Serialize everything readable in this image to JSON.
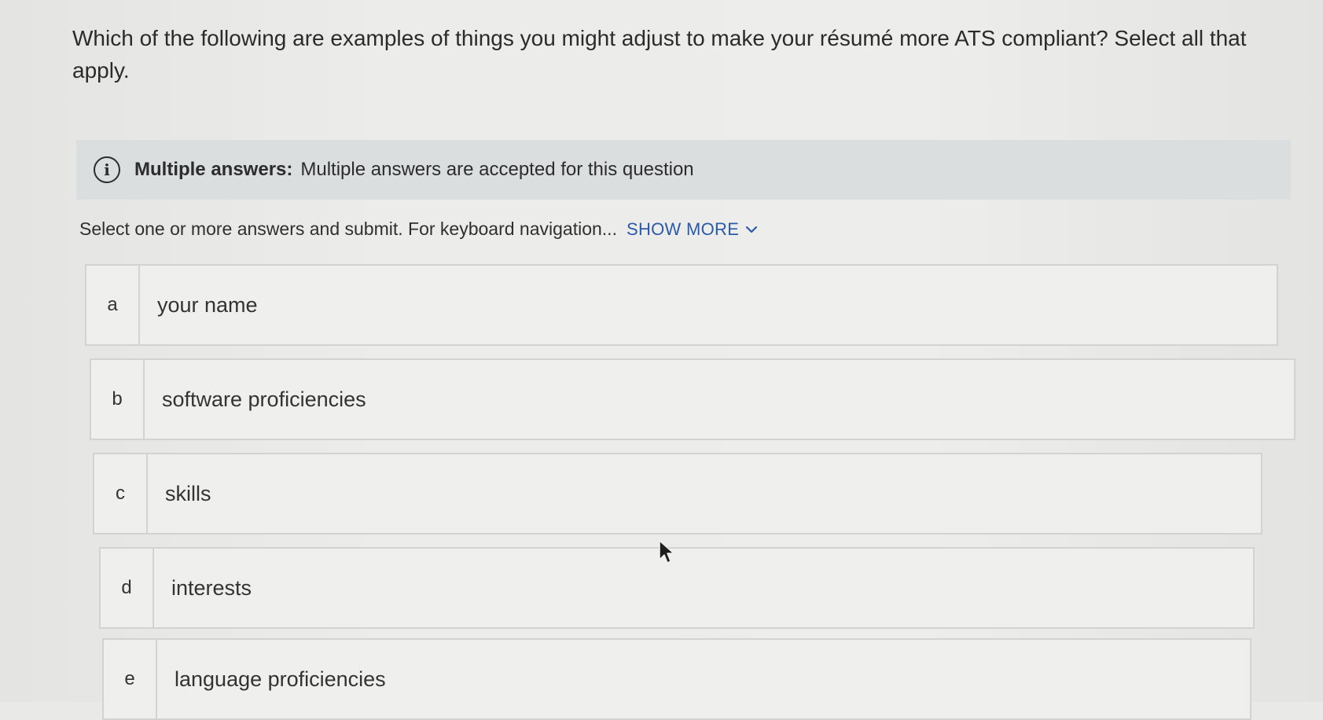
{
  "question": {
    "text": "Which of the following are examples of things you might adjust to make your résumé more ATS compliant? Select all that apply."
  },
  "banner": {
    "icon": "info-icon",
    "strong_label": "Multiple answers:",
    "text": "Multiple answers are accepted for this question"
  },
  "instructions": {
    "text": "Select one or more answers and submit. For keyboard navigation...",
    "show_more_label": "SHOW MORE",
    "show_more_icon": "chevron-down-icon",
    "link_color": "#2b5aa8"
  },
  "choices": [
    {
      "letter": "a",
      "label": "your name"
    },
    {
      "letter": "b",
      "label": "software proficiencies"
    },
    {
      "letter": "c",
      "label": "skills"
    },
    {
      "letter": "d",
      "label": "interests"
    },
    {
      "letter": "e",
      "label": "language proficiencies"
    }
  ],
  "cursor": {
    "icon": "mouse-pointer-icon"
  }
}
